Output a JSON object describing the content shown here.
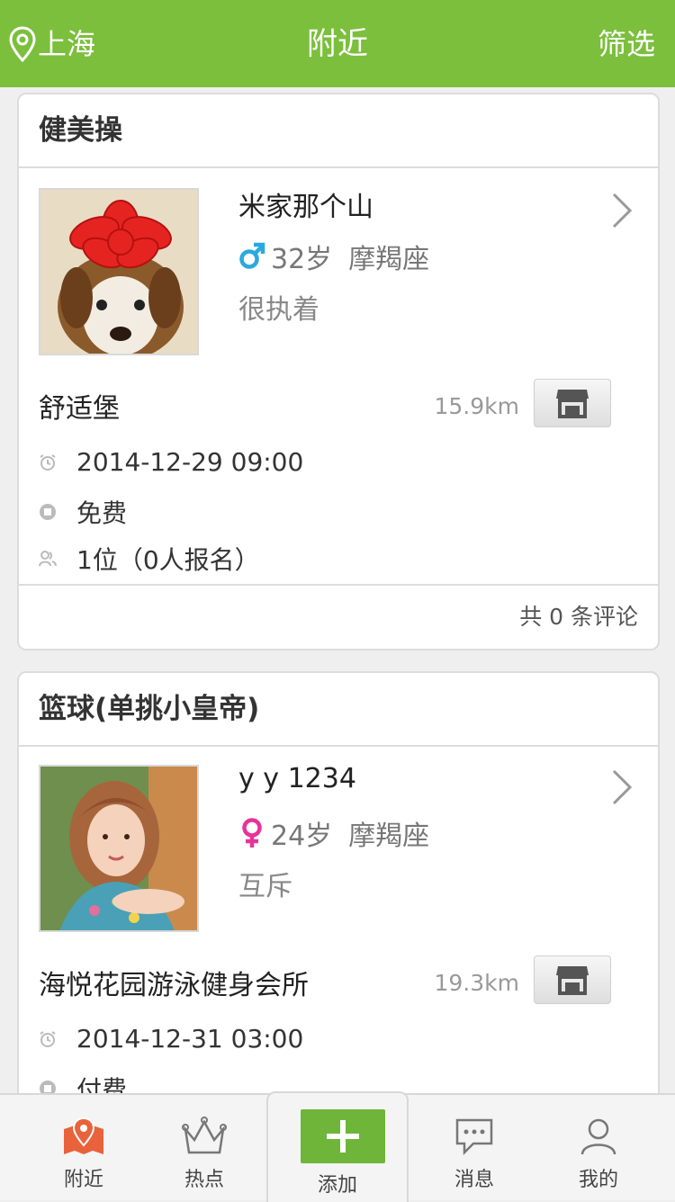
{
  "header": {
    "location": "上海",
    "title": "附近",
    "filter_label": "筛选"
  },
  "cards": [
    {
      "category": "健美操",
      "user": {
        "name": "米家那个山",
        "gender": "male",
        "age": "32岁",
        "zodiac": "摩羯座",
        "motto": "很执着"
      },
      "venue": "舒适堡",
      "distance": "15.9km",
      "time": "2014-12-29 09:00",
      "fee": "免费",
      "slots": "1位（0人报名）",
      "comments": "共 0 条评论"
    },
    {
      "category": "篮球(单挑小皇帝)",
      "user": {
        "name": "y y 1234",
        "gender": "female",
        "age": "24岁",
        "zodiac": "摩羯座",
        "motto": "互斥"
      },
      "venue": "海悦花园游泳健身会所",
      "distance": "19.3km",
      "time": "2014-12-31 03:00",
      "fee": "付费"
    }
  ],
  "tabs": {
    "nearby": "附近",
    "hot": "热点",
    "add": "添加",
    "messages": "消息",
    "mine": "我的"
  },
  "colors": {
    "brand_green": "#7bbf3c",
    "male_blue": "#29a9e0",
    "female_pink": "#e6349a",
    "active_tab": "#e8633c"
  },
  "icons": [
    "location-pin-icon",
    "chevron-right-icon",
    "male-icon",
    "female-icon",
    "shop-icon",
    "clock-icon",
    "coin-icon",
    "people-icon",
    "map-pin-icon",
    "crown-icon",
    "plus-icon",
    "chat-icon",
    "user-icon"
  ]
}
